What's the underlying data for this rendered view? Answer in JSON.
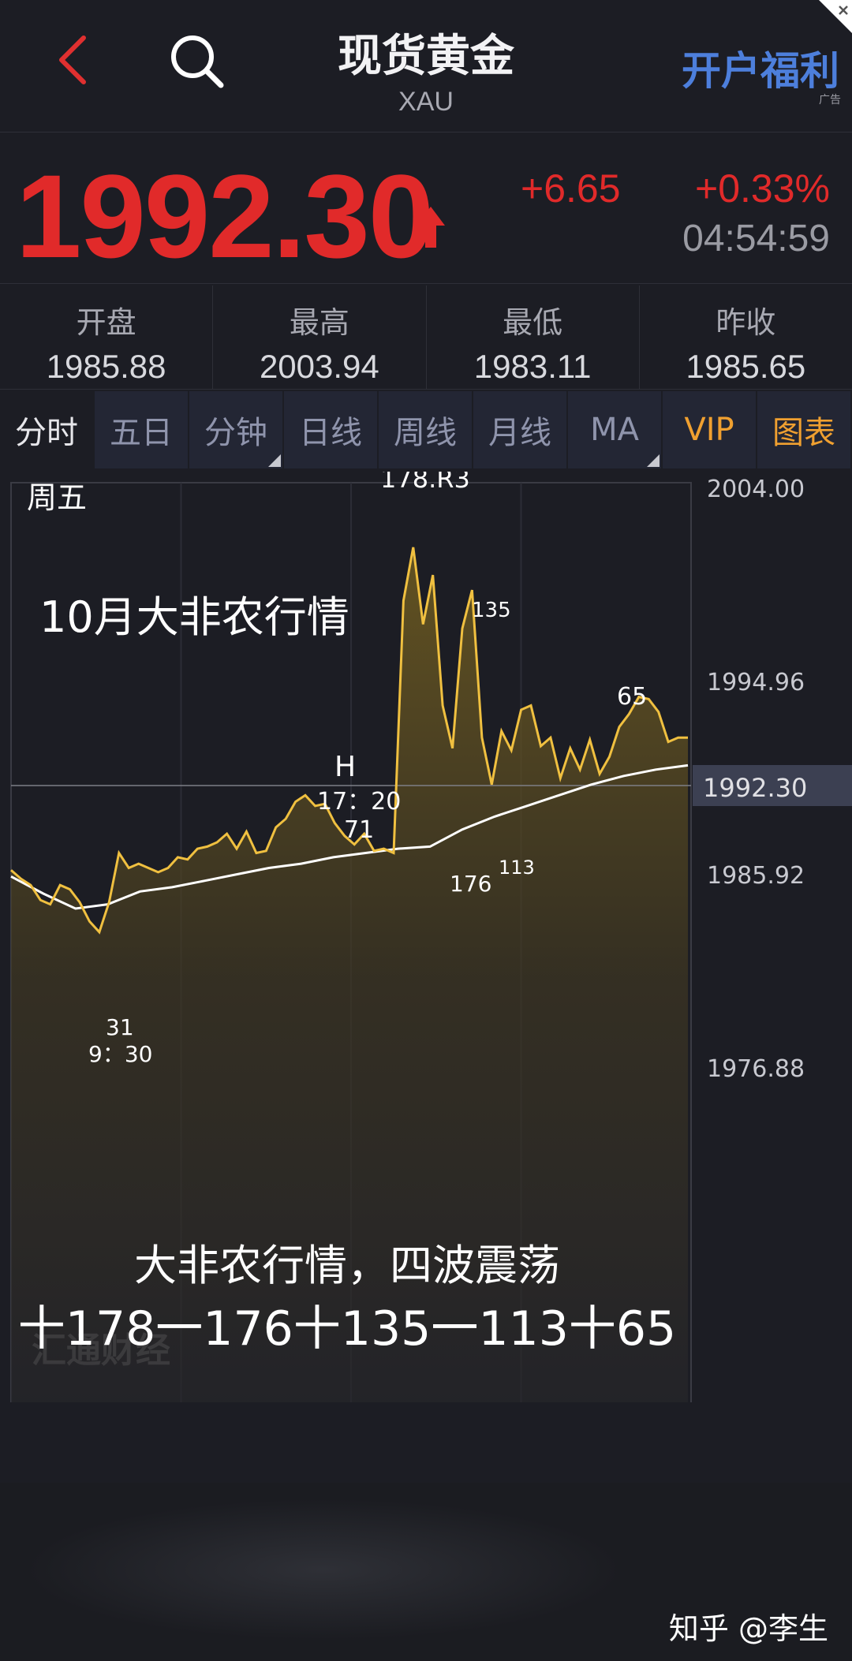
{
  "header": {
    "title": "现货黄金",
    "subtitle": "XAU",
    "promo": "开户福利",
    "ad_tag": "广告"
  },
  "quote": {
    "price": "1992.30",
    "change": "+6.65",
    "change_pct": "+0.33%",
    "time": "04:54:59",
    "color": "#e12a2a"
  },
  "stats": [
    {
      "label": "开盘",
      "value": "1985.88"
    },
    {
      "label": "最高",
      "value": "2003.94"
    },
    {
      "label": "最低",
      "value": "1983.11"
    },
    {
      "label": "昨收",
      "value": "1985.65"
    }
  ],
  "tabs": [
    {
      "label": "分时",
      "active": true
    },
    {
      "label": "五日"
    },
    {
      "label": "分钟"
    },
    {
      "label": "日线"
    },
    {
      "label": "周线"
    },
    {
      "label": "月线"
    },
    {
      "label": "MA"
    },
    {
      "label": "VIP"
    },
    {
      "label": "图表"
    }
  ],
  "chart": {
    "day_label": "周五",
    "overlay_title": "10月大非农行情",
    "summary_line1": "大非农行情，四波震荡",
    "summary_line2": "十178一176十135一113十65",
    "watermark": "汇通财经",
    "ticks": [
      "2004.00",
      "1994.96",
      "1985.92",
      "1976.88"
    ],
    "current_price_label": "1992.30",
    "annotations": {
      "peak": "178.R3",
      "a135": "135",
      "a65": "65",
      "h_mark": "H",
      "h_time": "17：20",
      "a71": "71",
      "a176": "176",
      "a113": "113",
      "a31": "31",
      "a31_time": "9：30"
    },
    "line_color": "#f0c040",
    "avg_line_color": "#ffffff"
  },
  "chart_data": {
    "type": "line",
    "series": [
      {
        "name": "",
        "values": [
          1986.1,
          1985.7,
          1985.4,
          1984.7,
          1984.5,
          1985.4,
          1985.2,
          1984.6,
          1983.7,
          1983.2,
          1984.6,
          1986.9,
          1986.2,
          1986.4,
          1986.2,
          1986.0,
          1986.2,
          1986.7,
          1986.6,
          1987.1,
          1987.2,
          1987.4,
          1987.8,
          1987.1,
          1987.9,
          1986.9,
          1987.0,
          1988.1,
          1988.5,
          1989.3,
          1989.6,
          1989.1,
          1989.2,
          1988.3,
          1987.7,
          1987.3,
          1987.8,
          1987.0,
          1987.1,
          1986.9,
          1998.7,
          2001.2,
          1997.6,
          1999.9,
          1993.8,
          1991.8,
          1997.4,
          1999.2,
          1992.3,
          1990.1,
          1992.6,
          1991.7,
          1993.6,
          1993.8,
          1991.9,
          1992.3,
          1990.4,
          1991.8,
          1990.8,
          1992.2,
          1990.6,
          1991.4,
          1992.8,
          1993.4,
          1994.2,
          1994.1,
          1993.5,
          1992.1,
          1992.3,
          1992.3
        ]
      },
      {
        "name": "",
        "values": [
          1985.8,
          1985.0,
          1984.3,
          1984.5,
          1985.1,
          1985.3,
          1985.6,
          1985.9,
          1986.2,
          1986.4,
          1986.7,
          1986.9,
          1987.1,
          1987.2,
          1988.0,
          1988.6,
          1989.1,
          1989.6,
          1990.1,
          1990.5,
          1990.8,
          1991.0
        ]
      }
    ],
    "y_axis_ticks": [
      2004.0,
      1994.96,
      1985.92,
      1976.88
    ],
    "ylim": [
      1972.2,
      2004.0
    ],
    "current": 1992.3
  }
}
